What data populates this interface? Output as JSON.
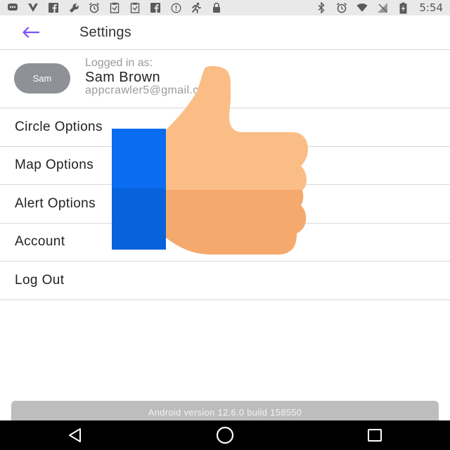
{
  "status_bar": {
    "time": "5:54",
    "left_icons": [
      "chat-icon",
      "vpn-icon",
      "facebook-icon",
      "wrench-icon",
      "alarm-icon",
      "clipboard-icon",
      "clipboard-icon",
      "facebook-icon",
      "info-icon",
      "run-icon",
      "lock-icon"
    ],
    "right_icons": [
      "bluetooth-icon",
      "alarm-icon",
      "wifi-icon",
      "signal-off-icon",
      "battery-charging-icon"
    ]
  },
  "app_bar": {
    "back_icon": "arrow-left-icon",
    "title": "Settings",
    "accent_color": "#7c4dff"
  },
  "profile": {
    "avatar_text": "Sam",
    "logged_in_label": "Logged in as:",
    "name": "Sam Brown",
    "email": "appcrawler5@gmail.com"
  },
  "menu": {
    "items": [
      {
        "label": "Circle Options"
      },
      {
        "label": "Map Options"
      },
      {
        "label": "Alert Options"
      },
      {
        "label": "Account"
      },
      {
        "label": "Log Out"
      }
    ]
  },
  "footer": {
    "version_text": "Android version 12.6.0 build 158550"
  },
  "nav_bar": {
    "icons": [
      "back-triangle-icon",
      "home-circle-icon",
      "recents-square-icon"
    ]
  },
  "overlay": {
    "icon": "thumbs-up-icon",
    "colors": {
      "sleeve": "#0a6cf0",
      "sleeve_dark": "#0862dc",
      "hand": "#fbbd86",
      "hand_shadow": "#f5a96c"
    }
  }
}
